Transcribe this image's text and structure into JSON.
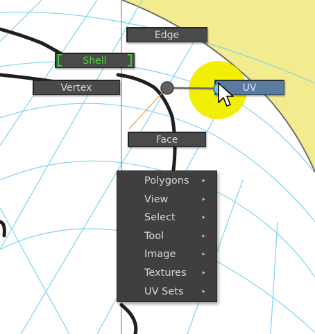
{
  "marking_menu": {
    "edge": "Edge",
    "shell": "Shell",
    "vertex": "Vertex",
    "uv": "UV",
    "face": "Face"
  },
  "submenu": {
    "items": [
      {
        "label": "Polygons",
        "arrow": "▸"
      },
      {
        "label": "View",
        "arrow": "▸"
      },
      {
        "label": "Select",
        "arrow": "▸"
      },
      {
        "label": "Tool",
        "arrow": "▸"
      },
      {
        "label": "Image",
        "arrow": "▸"
      },
      {
        "label": "Textures",
        "arrow": "▸"
      },
      {
        "label": "UV Sets",
        "arrow": "▸"
      }
    ]
  },
  "colors": {
    "uv_region": "#f3ec8e",
    "grid_line": "#7fd3ec",
    "highlight": "#f3ee05",
    "active_item": "#5a7aa0",
    "shell_text": "#4ade3a"
  },
  "icons": {
    "cursor": "arrow-pointer-icon",
    "center": "marking-menu-center-icon"
  }
}
